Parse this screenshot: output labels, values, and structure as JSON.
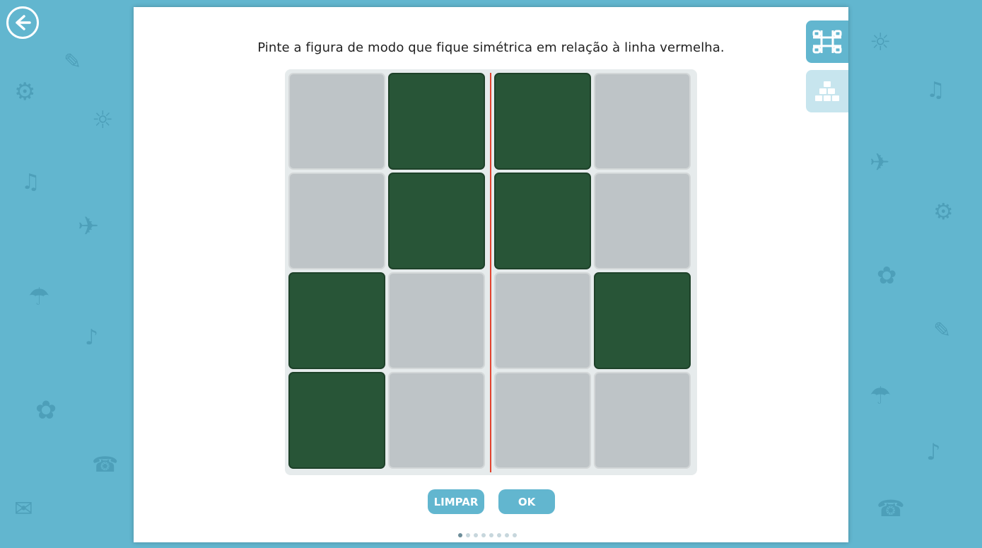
{
  "instruction": "Pinte a figura de modo que fique simétrica em relação à linha vermelha.",
  "grid": {
    "rows": [
      [
        false,
        true,
        true,
        false
      ],
      [
        false,
        true,
        true,
        false
      ],
      [
        true,
        false,
        false,
        true
      ],
      [
        true,
        false,
        false,
        false
      ]
    ],
    "colors": {
      "filled": "#285537",
      "empty": "#bec4c7",
      "mirror_line": "#e1442f"
    }
  },
  "buttons": {
    "clear_label": "LIMPAR",
    "ok_label": "OK"
  },
  "pagination": {
    "total": 8,
    "current": 1
  },
  "side_tabs": [
    {
      "icon": "grid-icon",
      "active": true
    },
    {
      "icon": "blocks-icon",
      "active": false
    }
  ],
  "nav": {
    "back_icon": "back-arrow-icon"
  },
  "theme": {
    "accent": "#62b6cf",
    "background": "#62b6cf"
  }
}
